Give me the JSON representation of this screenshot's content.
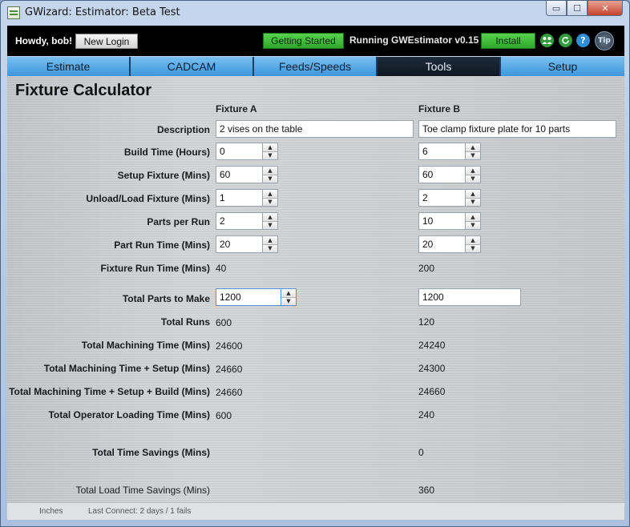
{
  "window": {
    "title": "GWizard: Estimator: Beta Test",
    "minimize": "▭",
    "maximize": "☐",
    "close": "✕"
  },
  "header": {
    "greeting": "Howdy, bob!",
    "new_login": "New Login",
    "getting_started": "Getting Started",
    "running": "Running GWEstimator v0.15",
    "install": "Install",
    "icons": [
      "users-icon",
      "refresh-icon",
      "help-icon",
      "tip-icon"
    ],
    "help_glyph": "?",
    "tip_text": "Tip"
  },
  "tabs": [
    "Estimate",
    "CADCAM",
    "Feeds/Speeds",
    "Tools",
    "Setup"
  ],
  "active_tab": "Tools",
  "page": {
    "title": "Fixture Calculator",
    "fixture_a": "Fixture A",
    "fixture_b": "Fixture B"
  },
  "labels": {
    "description": "Description",
    "build_time": "Build Time (Hours)",
    "setup_fixture": "Setup Fixture (Mins)",
    "unload_load": "Unload/Load Fixture (Mins)",
    "parts_per_run": "Parts per Run",
    "part_run_time": "Part Run Time (Mins)",
    "fixture_run_time": "Fixture Run Time (Mins)",
    "total_parts": "Total Parts to Make",
    "total_runs": "Total Runs",
    "total_machining": "Total Machining Time (Mins)",
    "total_machining_setup": "Total Machining Time + Setup (Mins)",
    "total_machining_setup_build": "Total Machining Time + Setup + Build (Mins)",
    "total_operator": "Total Operator Loading Time (Mins)",
    "total_time_savings": "Total Time Savings (Mins)",
    "total_load_savings": "Total Load Time Savings (Mins)"
  },
  "fixture_a": {
    "description": "2 vises on the table",
    "build_time": "0",
    "setup_fixture": "60",
    "unload_load": "1",
    "parts_per_run": "2",
    "part_run_time": "20",
    "fixture_run_time": "40",
    "total_parts": "1200",
    "total_runs": "600",
    "total_machining": "24600",
    "total_machining_setup": "24660",
    "total_machining_setup_build": "24660",
    "total_operator": "600"
  },
  "fixture_b": {
    "description": "Toe clamp fixture plate for 10 parts",
    "build_time": "6",
    "setup_fixture": "60",
    "unload_load": "2",
    "parts_per_run": "10",
    "part_run_time": "20",
    "fixture_run_time": "200",
    "total_parts": "1200",
    "total_runs": "120",
    "total_machining": "24240",
    "total_machining_setup": "24300",
    "total_machining_setup_build": "24660",
    "total_operator": "240",
    "total_time_savings": "0",
    "total_load_savings": "360"
  },
  "spin": {
    "up": "▲",
    "down": "▼"
  },
  "status": {
    "units": "Inches",
    "connection": "Last Connect: 2 days / 1 fails"
  }
}
